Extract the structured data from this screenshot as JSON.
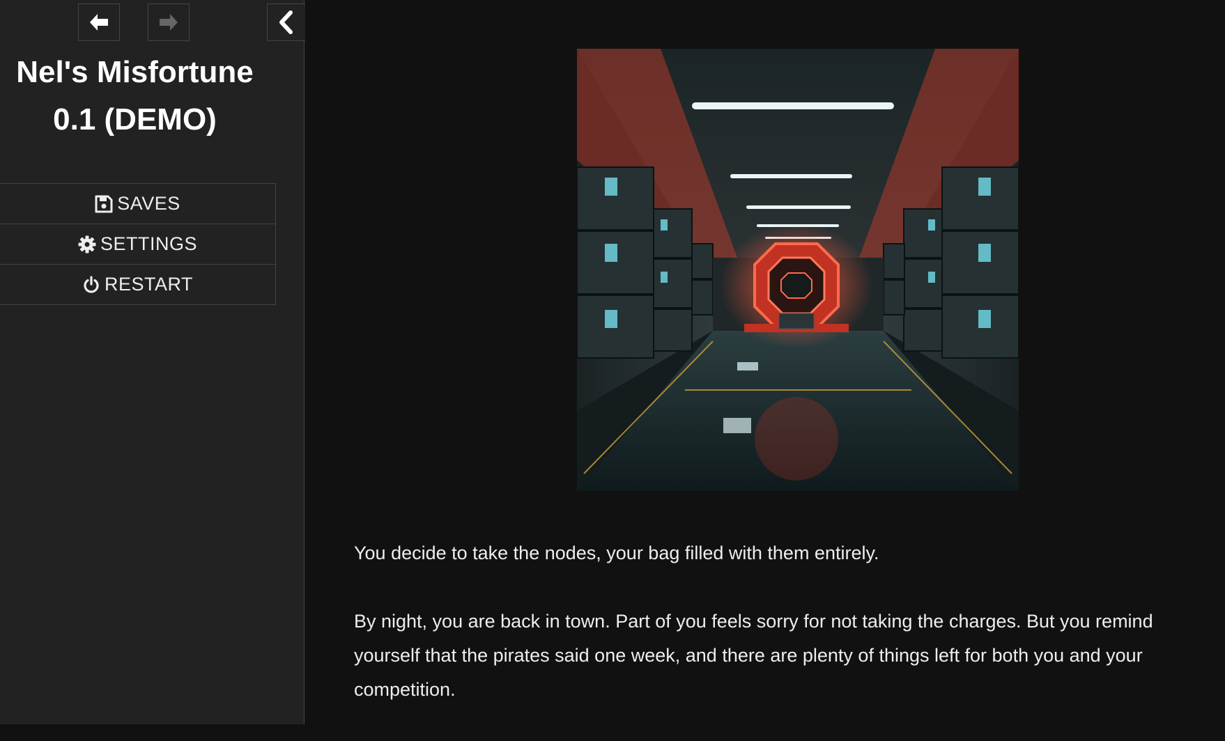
{
  "sidebar": {
    "nav": {
      "back_icon": "arrow-left-icon",
      "forward_icon": "arrow-right-icon",
      "stow_icon": "chevron-left-icon"
    },
    "title": "Nel's Misfortune 0.1 (DEMO)",
    "menu": [
      {
        "label": "SAVES",
        "icon": "floppy-disk-icon"
      },
      {
        "label": "SETTINGS",
        "icon": "gear-icon"
      },
      {
        "label": "RESTART",
        "icon": "power-icon"
      }
    ]
  },
  "passage": {
    "image_icon": "sci-fi-corridor-illustration",
    "paragraphs": [
      "You decide to take the nodes, your bag filled with them entirely.",
      "By night, you are back in town. Part of you feels sorry for not taking the charges. But you remind yourself that the pirates said one week, and there are plenty of things left for both you and your competition."
    ]
  },
  "colors": {
    "sidebar_bg": "#222222",
    "main_bg": "#111111",
    "border": "#444444",
    "text": "#eeeeee",
    "accent_red": "#e8402a",
    "accent_teal": "#6fd4e0"
  }
}
